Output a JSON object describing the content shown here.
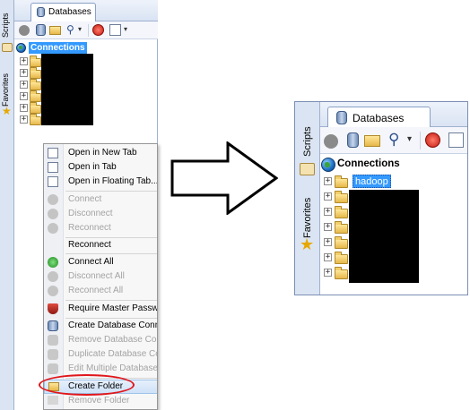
{
  "left_panel": {
    "sidebar_tabs": {
      "scripts": "Scripts",
      "favorites": "Favorites"
    },
    "tab_label": "Databases",
    "tree_root_label": "Connections",
    "folder_count": 6
  },
  "context_menu": {
    "items": [
      {
        "label": "Open in New Tab",
        "enabled": true,
        "icon": "open-tab-icon"
      },
      {
        "label": "Open in Tab",
        "enabled": true,
        "icon": "open-tab-icon"
      },
      {
        "label": "Open in Floating Tab...",
        "enabled": true,
        "icon": "floating-tab-icon"
      },
      {
        "label": "Connect",
        "enabled": false,
        "icon": "connect-icon"
      },
      {
        "label": "Disconnect",
        "enabled": false,
        "icon": "disconnect-icon"
      },
      {
        "label": "Reconnect",
        "enabled": false,
        "icon": "reconnect-icon"
      },
      {
        "label": "Reconnect",
        "enabled": true,
        "icon": ""
      },
      {
        "label": "Connect All",
        "enabled": true,
        "icon": "connect-all-icon"
      },
      {
        "label": "Disconnect All",
        "enabled": false,
        "icon": "disconnect-all-icon"
      },
      {
        "label": "Reconnect All",
        "enabled": false,
        "icon": "reconnect-all-icon"
      },
      {
        "label": "Require Master Password",
        "enabled": true,
        "icon": "shield-icon"
      },
      {
        "label": "Create Database Connect",
        "enabled": true,
        "icon": "database-icon"
      },
      {
        "label": "Remove Database Conne",
        "enabled": false,
        "icon": "remove-database-icon"
      },
      {
        "label": "Duplicate Database Conn",
        "enabled": false,
        "icon": "duplicate-database-icon"
      },
      {
        "label": "Edit Multiple Database Co",
        "enabled": false,
        "icon": "edit-database-icon"
      },
      {
        "label": "Create Folder",
        "enabled": true,
        "icon": "create-folder-icon"
      },
      {
        "label": "Remove Folder",
        "enabled": false,
        "icon": "remove-folder-icon"
      }
    ]
  },
  "zoom_panel": {
    "sidebar_tabs": {
      "scripts": "Scripts",
      "favorites": "Favorites"
    },
    "tab_label": "Databases",
    "tree_root_label": "Connections",
    "selected_folder_label": "hadoop",
    "folder_count": 7
  },
  "colors": {
    "selection": "#3399ff",
    "highlight_ellipse": "#e0161b",
    "panel_border": "#9fb1cf"
  }
}
